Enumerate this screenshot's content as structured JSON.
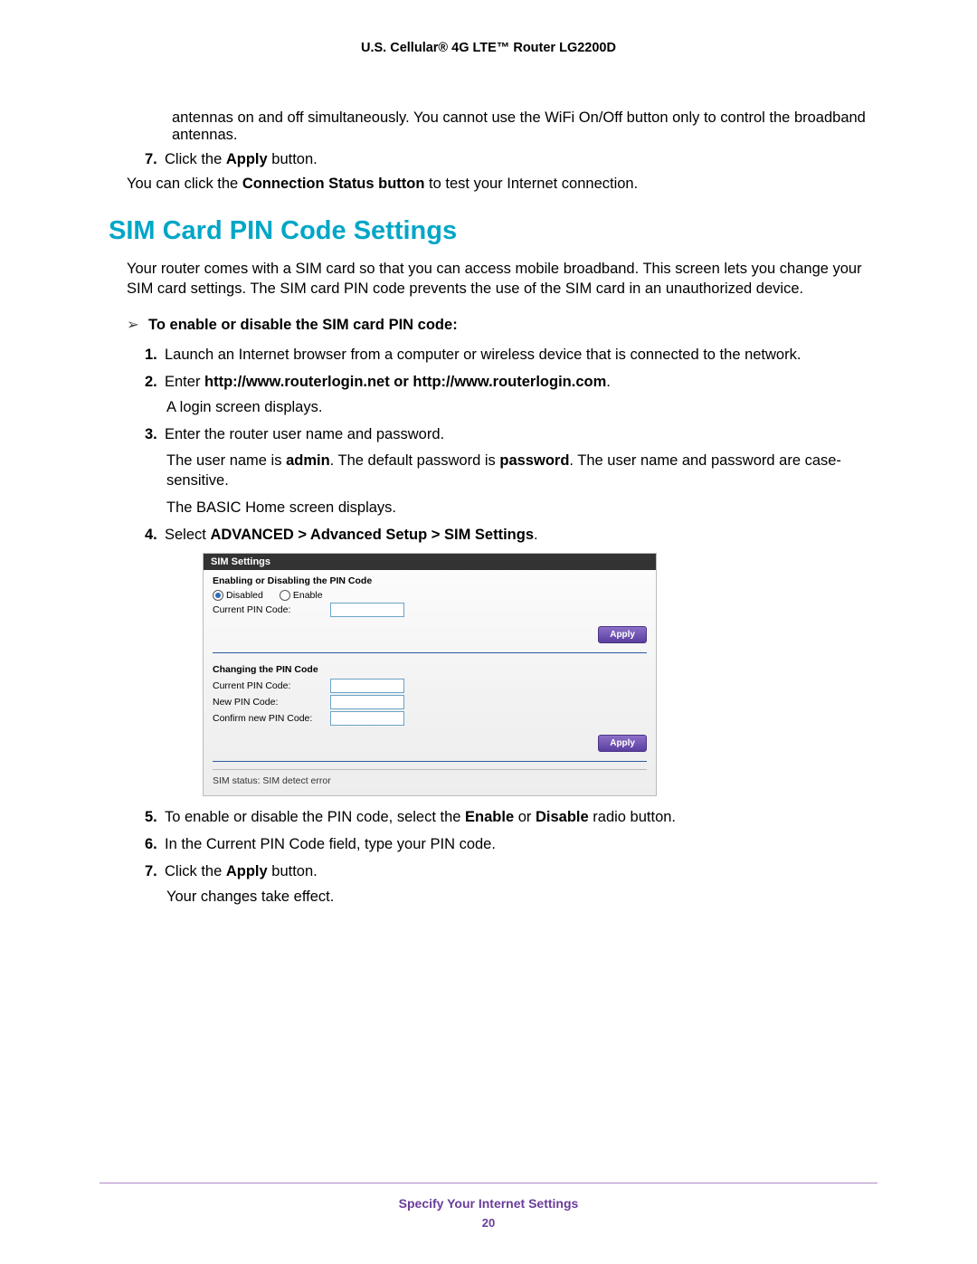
{
  "header": {
    "title": "U.S. Cellular® 4G LTE™ Router LG2200D"
  },
  "top": {
    "antenna_text": "antennas on and off simultaneously. You cannot use the WiFi On/Off button only to control the broadband antennas.",
    "step7_marker": "7.",
    "step7_pre": "Click the ",
    "step7_bold": "Apply",
    "step7_post": " button.",
    "post7_pre": "You can click the ",
    "post7_bold": "Connection Status button",
    "post7_post": " to test your Internet connection."
  },
  "section": {
    "title": "SIM Card PIN Code Settings"
  },
  "intro": "Your router comes with a SIM card so that you can access mobile broadband. This screen lets you change your SIM card settings. The SIM card PIN code prevents the use of the SIM card in an unauthorized device.",
  "proc_title": "To enable or disable the SIM card PIN code:",
  "steps": {
    "s1_marker": "1.",
    "s1": "Launch an Internet browser from a computer or wireless device that is connected to the network.",
    "s2_marker": "2.",
    "s2_pre": "Enter ",
    "s2_bold": "http://www.routerlogin.net or http://www.routerlogin.com",
    "s2_post": ".",
    "s2_sub": "A login screen displays.",
    "s3_marker": "3.",
    "s3": "Enter the router user name and password.",
    "s3_sub1_a": "The user name is ",
    "s3_sub1_b": "admin",
    "s3_sub1_c": ". The default password is ",
    "s3_sub1_d": "password",
    "s3_sub1_e": ". The user name and password are case-sensitive.",
    "s3_sub2": "The BASIC Home screen displays.",
    "s4_marker": "4.",
    "s4_pre": "Select ",
    "s4_bold": "ADVANCED > Advanced Setup > SIM Settings",
    "s4_post": "."
  },
  "shot": {
    "title": "SIM Settings",
    "sec1_hdr": "Enabling or Disabling the PIN Code",
    "disabled": "Disabled",
    "enable": "Enable",
    "current_pin": "Current PIN Code:",
    "apply": "Apply",
    "sec2_hdr": "Changing the PIN Code",
    "current_pin2": "Current PIN Code:",
    "new_pin": "New PIN Code:",
    "confirm_pin": "Confirm new PIN Code:",
    "sim_status": "SIM status: SIM detect error"
  },
  "steps2": {
    "s5_marker": "5.",
    "s5_pre": "To enable or disable the PIN code, select the ",
    "s5_b1": "Enable",
    "s5_mid": " or ",
    "s5_b2": "Disable",
    "s5_post": " radio button.",
    "s6_marker": "6.",
    "s6": "In the Current PIN Code field, type your PIN code.",
    "s7_marker": "7.",
    "s7_pre": "Click the ",
    "s7_bold": "Apply",
    "s7_post": " button.",
    "s7_sub": "Your changes take effect."
  },
  "footer": {
    "section": "Specify Your Internet Settings",
    "page": "20"
  }
}
